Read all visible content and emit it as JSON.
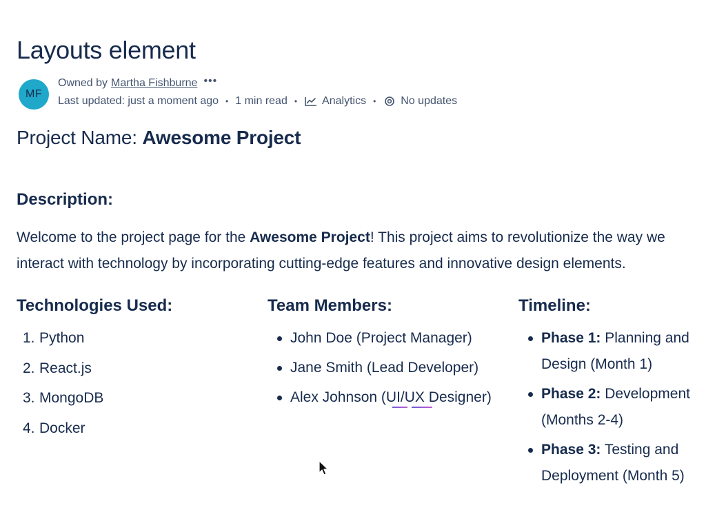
{
  "page": {
    "title": "Layouts element"
  },
  "byline": {
    "avatar_initials": "MF",
    "avatar_color": "#1fa8c9",
    "owned_by_label": "Owned by",
    "owner_name": "Martha Fishburne",
    "more_label": "•••",
    "last_updated": "Last updated: just a moment ago",
    "read_time": "1 min read",
    "analytics_label": "Analytics",
    "analytics_icon": "chart-line-icon",
    "updates_label": "No updates",
    "updates_icon": "watch-icon",
    "separator": "•"
  },
  "project": {
    "name_prefix": "Project Name: ",
    "name": "Awesome Project"
  },
  "description": {
    "heading": "Description:",
    "text_before": "Welcome to the project page for the ",
    "bold": "Awesome Project",
    "text_after": "! This project aims to revolutionize the way we interact with technology by incorporating cutting-edge features and innovative design elements."
  },
  "technologies": {
    "heading": "Technologies Used:",
    "items": [
      {
        "num": "1.",
        "label": "Python"
      },
      {
        "num": "2.",
        "label": "React.js"
      },
      {
        "num": "3.",
        "label": "MongoDB"
      },
      {
        "num": "4.",
        "label": "Docker"
      }
    ]
  },
  "team": {
    "heading": "Team Members:",
    "items": [
      "John Doe (Project Manager)",
      "Jane Smith (Lead Developer)"
    ],
    "item3_prefix": "Alex Johnson (",
    "item3_highlight": "UI/UX",
    "item3_suffix": " Designer)"
  },
  "timeline": {
    "heading": "Timeline:",
    "items": [
      {
        "phase": "Phase 1:",
        "text": " Planning and Design (Month 1)"
      },
      {
        "phase": "Phase 2:",
        "text": " Development (Months 2-4)"
      },
      {
        "phase": "Phase 3:",
        "text": " Testing and Deployment (Month 5)"
      }
    ]
  },
  "colors": {
    "text": "#172b4d",
    "subtle_text": "#44546f",
    "spellcheck_underline": "#8f5bd6"
  }
}
